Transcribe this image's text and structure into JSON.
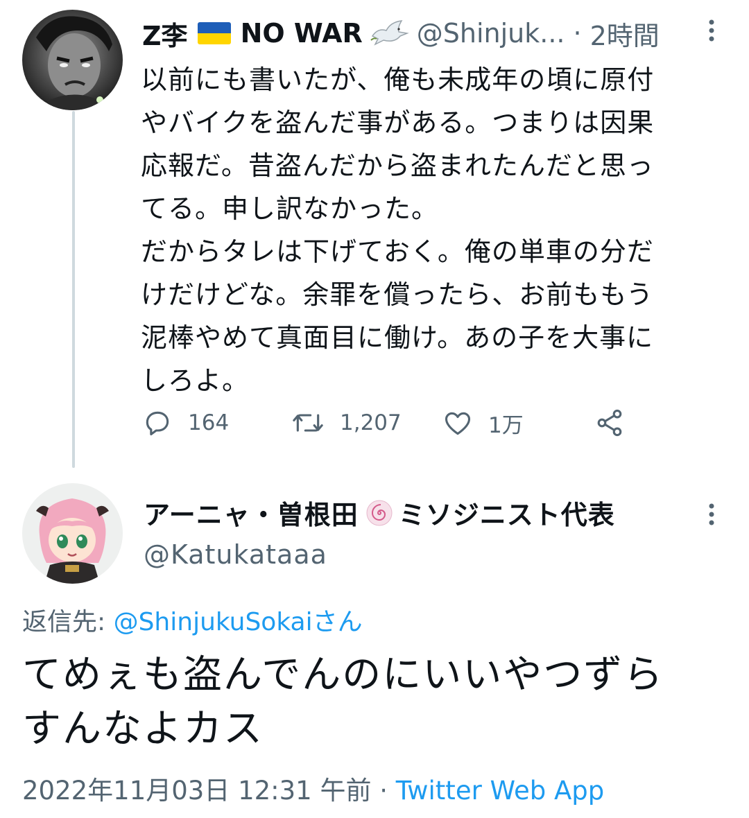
{
  "tweet1": {
    "display_name": "Z李",
    "name_suffix": "NO WAR",
    "handle": "@Shinjuk...",
    "separator": "·",
    "time": "2時間",
    "text": "以前にも書いたが、俺も未成年の頃に原付\nやバイクを盗んだ事がある。つまりは因果\n応報だ。昔盗んだから盗まれたんだと思っ\nてる。申し訳なかった。\nだからタレは下げておく。俺の単車の分だ\nけだけどな。余罪を償ったら、お前ももう\n泥棒やめて真面目に働け。あの子を大事に\nしろよ。",
    "flag_colors": {
      "top": "#1e5eb8",
      "bottom": "#ffd500"
    },
    "actions": {
      "reply_count": "164",
      "retweet_count": "1,207",
      "like_count": "1万"
    }
  },
  "tweet2": {
    "display_name_part1": "アーニャ・曽根田",
    "display_name_part2": "ミソジニスト代表",
    "handle": "@Katukataaa",
    "reply_to_prefix": "返信先: ",
    "reply_to_mention": "@ShinjukuSokaiさん",
    "text": "てめぇも盗んでんのにいいやつずら\nすんなよカス",
    "timestamp": "2022年11月03日 12:31 午前",
    "separator": " · ",
    "source": "Twitter Web App"
  },
  "colors": {
    "text": "#0f1419",
    "secondary": "#536471",
    "link": "#1d9bf0",
    "thread_line": "#cfd9de"
  }
}
